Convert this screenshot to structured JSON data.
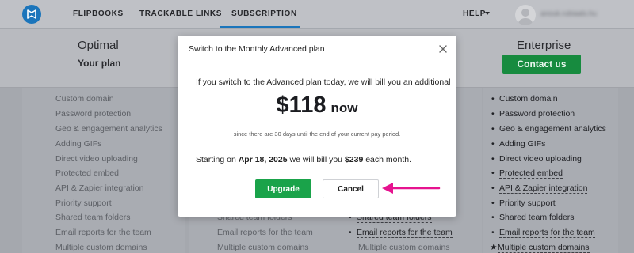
{
  "nav": {
    "links": [
      "FLIPBOOKS",
      "TRACKABLE LINKS",
      "SUBSCRIPTION"
    ],
    "help": "HELP",
    "user_name": "anouk.rubiaals.hu"
  },
  "plans": {
    "optimal": {
      "name": "Optimal",
      "subtitle": "Your plan"
    },
    "enterprise": {
      "name": "Enterprise",
      "button": "Contact us"
    }
  },
  "features": {
    "left": [
      "Custom domain",
      "Password protection",
      "Geo & engagement analytics",
      "Adding GIFs",
      "Direct video uploading",
      "Protected embed",
      "API & Zapier integration",
      "Priority support",
      "Shared team folders",
      "Email reports for the team",
      "Multiple custom domains"
    ],
    "mid": [
      "Shared team folders",
      "Email reports for the team",
      "Multiple custom domains"
    ],
    "mid2": [
      "Shared team folders",
      "Email reports for the team",
      "Multiple custom domains"
    ],
    "right": [
      "Custom domain",
      "Password protection",
      "Geo & engagement analytics",
      "Adding GIFs",
      "Direct video uploading",
      "Protected embed",
      "API & Zapier integration",
      "Priority support",
      "Shared team folders",
      "Email reports for the team",
      "Multiple custom domains"
    ]
  },
  "modal": {
    "title": "Switch to the Monthly Advanced plan",
    "line1": "If you switch to the Advanced plan today, we will bill you an additional",
    "amount": "$118",
    "amount_suffix": "now",
    "note": "since there are 30 days until the end of your current pay period.",
    "line2_prefix": "Starting on ",
    "line2_date": "Apr 18, 2025",
    "line2_middle": " we will bill you ",
    "line2_price": "$239",
    "line2_suffix": " each month.",
    "upgrade": "Upgrade",
    "cancel": "Cancel"
  },
  "colors": {
    "accent": "#1b75bb",
    "upgrade_green": "#1aa34a",
    "annotation_arrow": "#e6138f"
  },
  "icons": [
    "logo-icon",
    "caret-down-icon",
    "avatar-icon",
    "close-icon",
    "bullet-icon",
    "star-icon",
    "arrow-annotation-icon"
  ]
}
